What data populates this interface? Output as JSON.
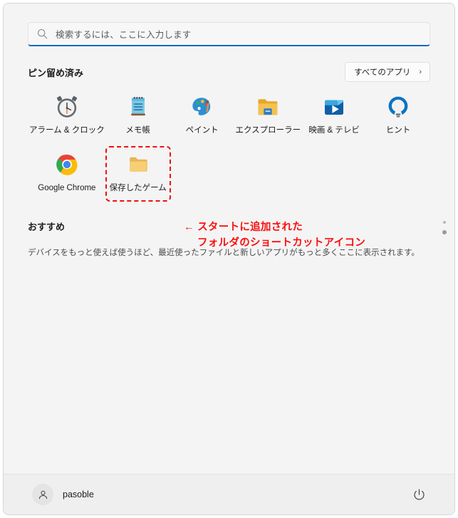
{
  "window": {
    "title": "Windows 11 Start Menu"
  },
  "search": {
    "placeholder": "検索するには、ここに入力します",
    "value": "",
    "icon": "search-icon",
    "accent_color": "#0f6cbd"
  },
  "pinned": {
    "title": "ピン留め済み",
    "all_apps_label": "すべてのアプリ",
    "all_apps_chevron": "›",
    "apps": [
      {
        "label": "アラーム & クロック",
        "icon": "alarm-clock-icon",
        "highlighted": false
      },
      {
        "label": "メモ帳",
        "icon": "notepad-icon",
        "highlighted": false
      },
      {
        "label": "ペイント",
        "icon": "paint-icon",
        "highlighted": false
      },
      {
        "label": "エクスプローラー",
        "icon": "file-explorer-icon",
        "highlighted": false
      },
      {
        "label": "映画 & テレビ",
        "icon": "movies-tv-icon",
        "highlighted": false
      },
      {
        "label": "ヒント",
        "icon": "tips-lightbulb-icon",
        "highlighted": false
      },
      {
        "label": "Google Chrome",
        "icon": "google-chrome-icon",
        "highlighted": false
      },
      {
        "label": "保存したゲーム",
        "icon": "folder-icon",
        "highlighted": true
      }
    ],
    "page_dots": {
      "count": 2,
      "active_index": 1
    }
  },
  "annotation": {
    "line1": "← スタートに追加された",
    "line2": "フォルダのショートカットアイコン",
    "color": "#fa0f0f"
  },
  "recommended": {
    "title": "おすすめ",
    "empty_text": "デバイスをもっと使えば使うほど、最近使ったファイルと新しいアプリがもっと多くここに表示されます。"
  },
  "footer": {
    "user_name": "pasoble",
    "avatar_icon": "user-avatar-icon",
    "power_icon": "power-icon"
  }
}
